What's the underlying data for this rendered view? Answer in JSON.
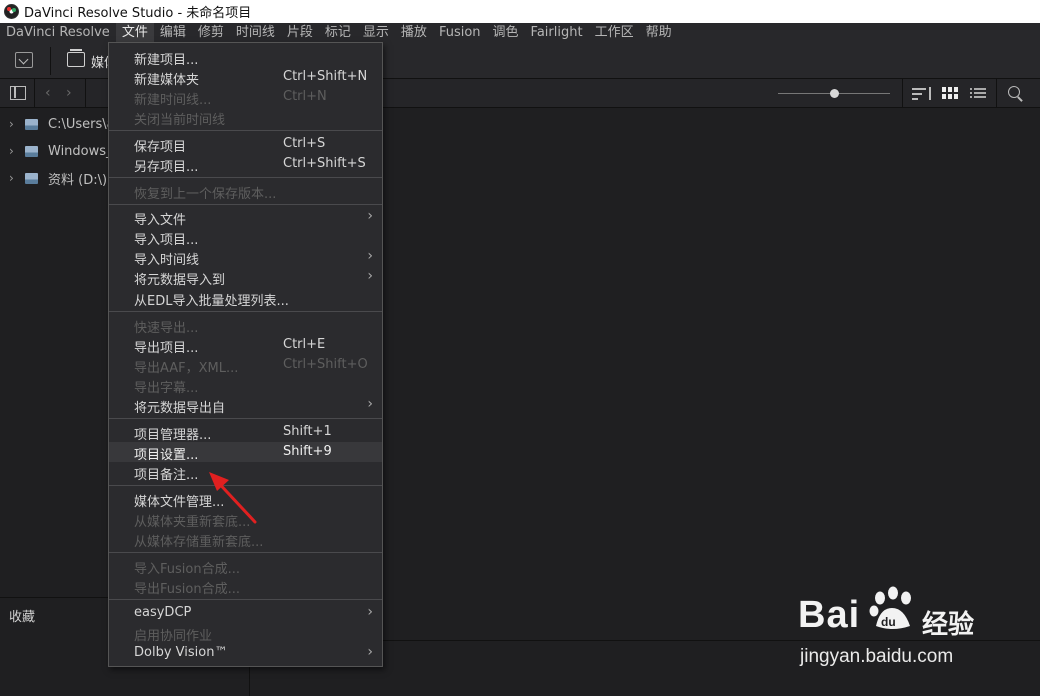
{
  "window": {
    "title": "DaVinci Resolve Studio - 未命名项目"
  },
  "menubar": {
    "items": [
      "DaVinci Resolve",
      "文件",
      "编辑",
      "修剪",
      "时间线",
      "片段",
      "标记",
      "显示",
      "播放",
      "Fusion",
      "调色",
      "Fairlight",
      "工作区",
      "帮助"
    ],
    "active_index": 1
  },
  "toolbar": {
    "media_label": "媒体池"
  },
  "left_panel": {
    "tree": [
      {
        "label": "C:\\Users\\a"
      },
      {
        "label": "Windows_"
      },
      {
        "label": "资料 (D:\\)"
      }
    ],
    "favorites_label": "收藏"
  },
  "file_menu": {
    "items": [
      {
        "label": "新建项目...",
        "shortcut": ""
      },
      {
        "label": "新建媒体夹",
        "shortcut": "Ctrl+Shift+N"
      },
      {
        "label": "新建时间线...",
        "shortcut": "Ctrl+N"
      },
      {
        "label": "关闭当前时间线",
        "shortcut": ""
      },
      {
        "label": "保存项目",
        "shortcut": "Ctrl+S"
      },
      {
        "label": "另存项目...",
        "shortcut": "Ctrl+Shift+S"
      },
      {
        "label": "恢复到上一个保存版本...",
        "shortcut": ""
      },
      {
        "label": "导入文件",
        "shortcut": ""
      },
      {
        "label": "导入项目...",
        "shortcut": ""
      },
      {
        "label": "导入时间线",
        "shortcut": ""
      },
      {
        "label": "将元数据导入到",
        "shortcut": ""
      },
      {
        "label": "从EDL导入批量处理列表...",
        "shortcut": ""
      },
      {
        "label": "快速导出...",
        "shortcut": ""
      },
      {
        "label": "导出项目...",
        "shortcut": "Ctrl+E"
      },
      {
        "label": "导出AAF，XML...",
        "shortcut": "Ctrl+Shift+O"
      },
      {
        "label": "导出字幕...",
        "shortcut": ""
      },
      {
        "label": "将元数据导出自",
        "shortcut": ""
      },
      {
        "label": "项目管理器...",
        "shortcut": "Shift+1"
      },
      {
        "label": "项目设置...",
        "shortcut": "Shift+9"
      },
      {
        "label": "项目备注...",
        "shortcut": ""
      },
      {
        "label": "媒体文件管理...",
        "shortcut": ""
      },
      {
        "label": "从媒体夹重新套底...",
        "shortcut": ""
      },
      {
        "label": "从媒体存储重新套底...",
        "shortcut": ""
      },
      {
        "label": "导入Fusion合成...",
        "shortcut": ""
      },
      {
        "label": "导出Fusion合成...",
        "shortcut": ""
      },
      {
        "label": "easyDCP",
        "shortcut": ""
      },
      {
        "label": "启用协同作业",
        "shortcut": ""
      },
      {
        "label": "Dolby Vision™",
        "shortcut": ""
      }
    ]
  },
  "watermark": {
    "brand": "Bai",
    "brand2": "du",
    "cn": "经验",
    "url": "jingyan.baidu.com"
  },
  "colors": {
    "background": "#1f1f21",
    "menu_bg": "#2b2b2e",
    "highlight": "#38383b",
    "arrow": "#e02020"
  }
}
